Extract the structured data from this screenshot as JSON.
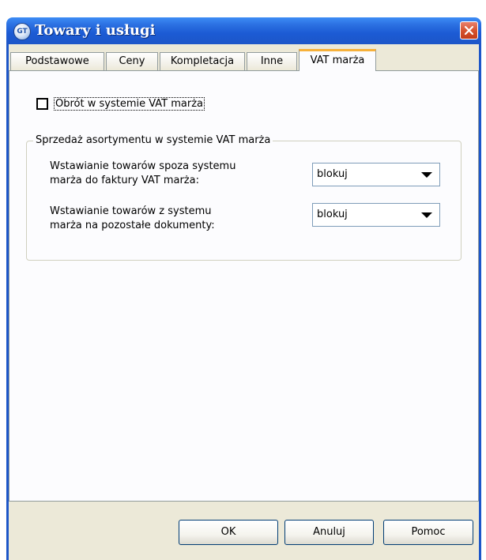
{
  "window": {
    "title": "Towary i usługi",
    "app_icon_text": "GT",
    "title_color": "#1d56c8"
  },
  "tabs": [
    {
      "label": "Podstawowe"
    },
    {
      "label": "Ceny"
    },
    {
      "label": "Kompletacja"
    },
    {
      "label": "Inne"
    },
    {
      "label": "VAT marża",
      "active": true
    }
  ],
  "vat_margin": {
    "checkbox_label": "Obrót w systemie VAT marża",
    "checked": false,
    "group_title": "Sprzedaż asortymentu w systemie VAT marża",
    "fields": [
      {
        "label_line1": "Wstawianie towarów spoza systemu",
        "label_line2": "marża do faktury VAT marża:",
        "value": "blokuj"
      },
      {
        "label_line1": "Wstawianie towarów z systemu",
        "label_line2": "marża na pozostałe dokumenty:",
        "value": "blokuj"
      }
    ]
  },
  "buttons": {
    "ok": "OK",
    "cancel": "Anuluj",
    "help": "Pomoc"
  }
}
